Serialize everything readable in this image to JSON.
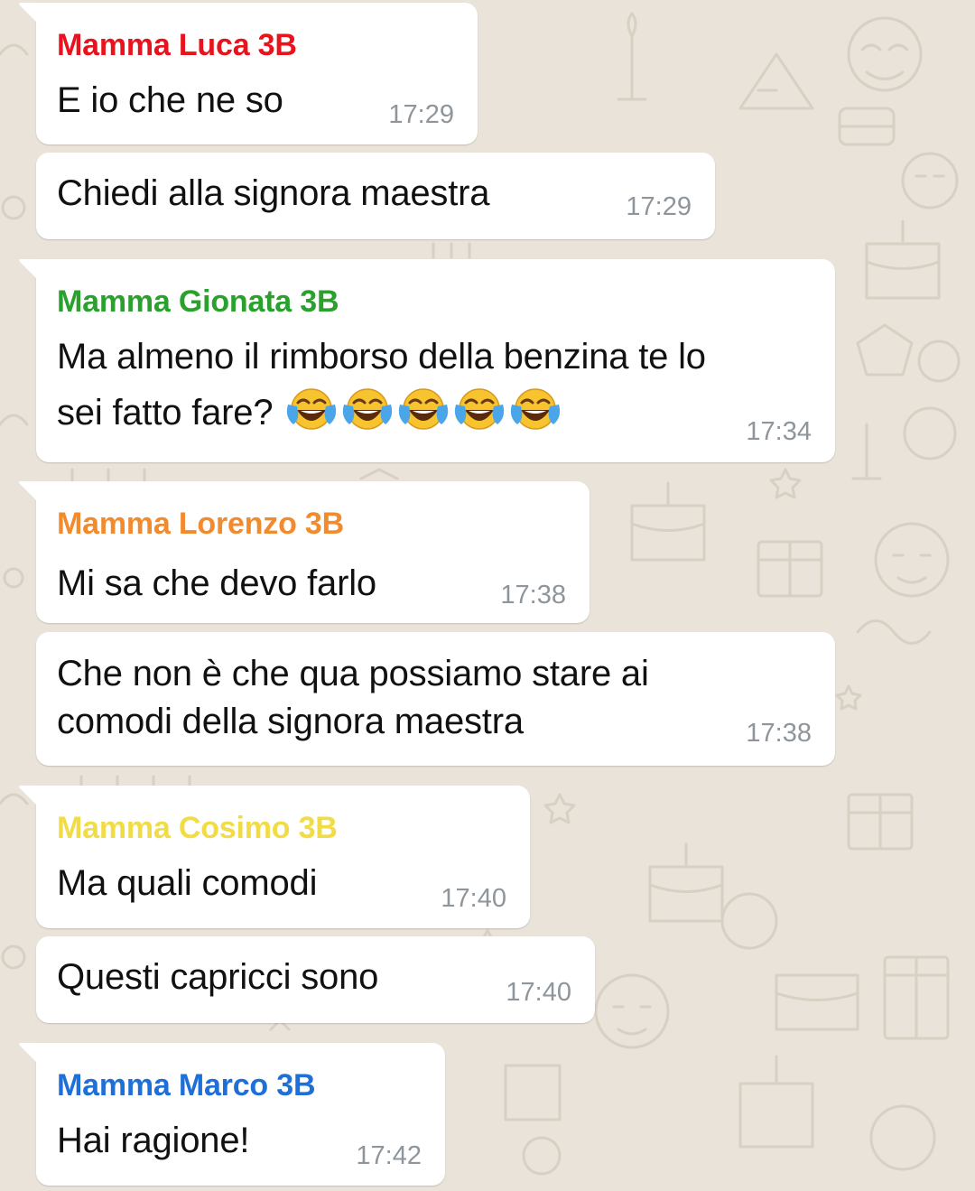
{
  "colors": {
    "background": "#e9e3d9",
    "bubble": "#ffffff",
    "time": "#8e959b",
    "text": "#111111"
  },
  "messages": [
    {
      "sender": "Mamma Luca 3B",
      "sender_color": "#e8131c",
      "text": "E io che ne so",
      "time": "17:29"
    },
    {
      "text": "Chiedi alla signora maestra",
      "time": "17:29"
    },
    {
      "sender": "Mamma Gionata 3B",
      "sender_color": "#2aa12c",
      "text_line1": "Ma almeno il rimborso della benzina te lo",
      "text_line2": "sei fatto fare?",
      "emoji": "face-with-tears-of-joy",
      "emoji_count": 5,
      "time": "17:34"
    },
    {
      "sender": "Mamma Lorenzo 3B",
      "sender_color": "#f28a2e",
      "text": "Mi sa che devo farlo",
      "time": "17:38"
    },
    {
      "text_line1": "Che non è che qua possiamo stare ai",
      "text_line2": "comodi della signora maestra",
      "time": "17:38"
    },
    {
      "sender": "Mamma Cosimo 3B",
      "sender_color": "#f2dc45",
      "text": "Ma quali comodi",
      "time": "17:40"
    },
    {
      "text": "Questi capricci sono",
      "time": "17:40"
    },
    {
      "sender": "Mamma Marco 3B",
      "sender_color": "#1f6fd8",
      "text": "Hai ragione!",
      "time": "17:42"
    }
  ]
}
